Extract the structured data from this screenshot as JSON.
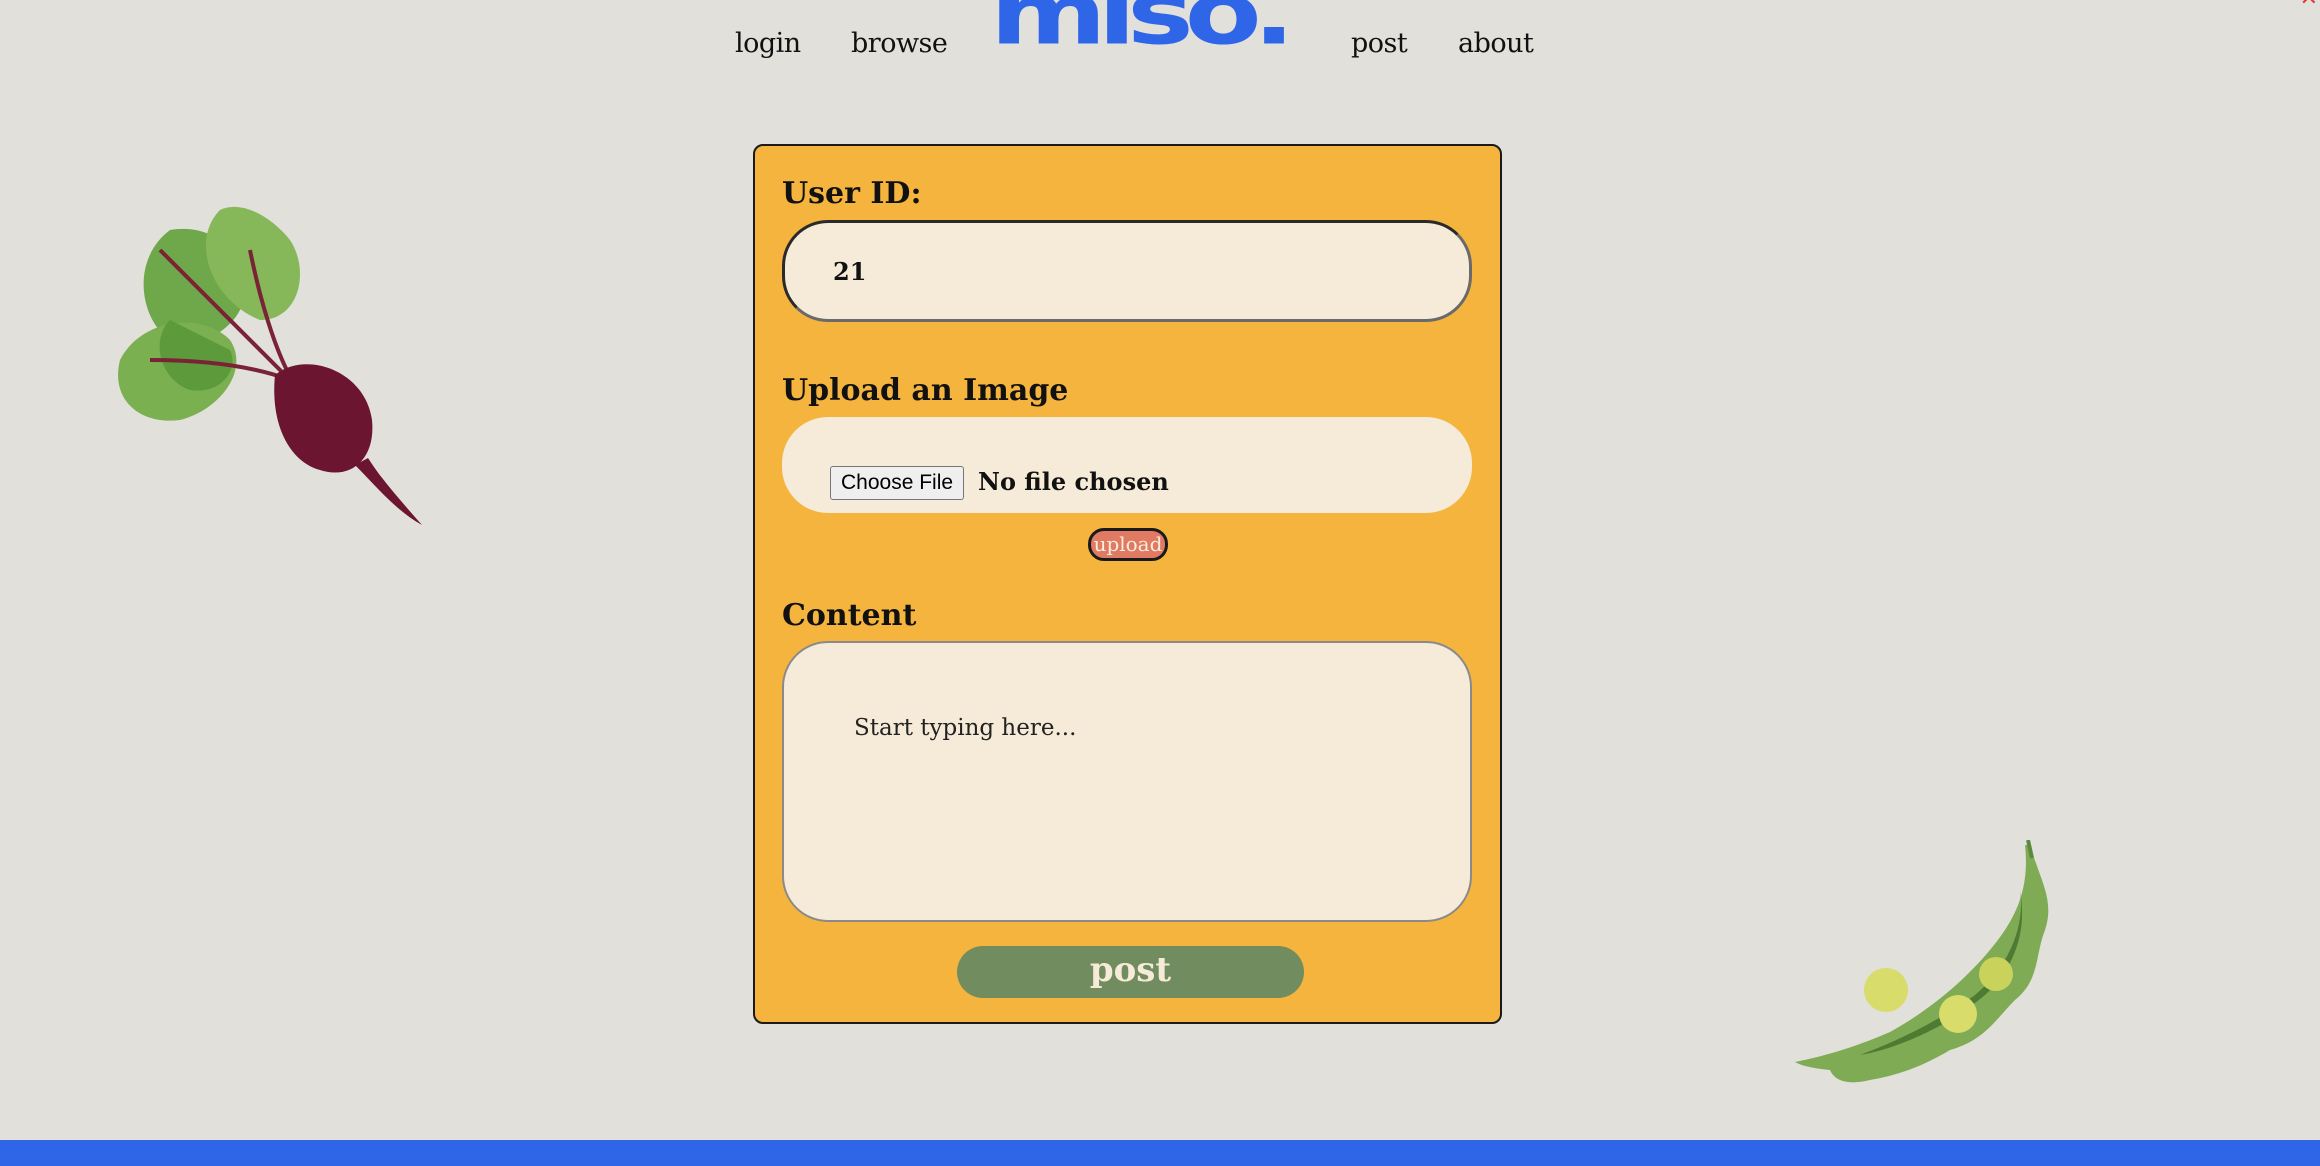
{
  "nav": {
    "links": [
      "login",
      "browse",
      "post",
      "about"
    ],
    "logo": "miso."
  },
  "form": {
    "user_id_label": "User ID:",
    "user_id_value": "21",
    "upload_label": "Upload an Image",
    "choose_file_label": "Choose File",
    "no_file_text": "No file chosen",
    "upload_button": "upload",
    "content_label": "Content",
    "content_placeholder": "Start typing here...",
    "post_button": "post"
  },
  "colors": {
    "background": "#e1e0db",
    "brand_blue": "#2f66e8",
    "panel_orange": "#f4b43e",
    "field_cream": "#f6ebd8",
    "upload_salmon": "#e07a62",
    "post_green": "#718c5e"
  },
  "icons": [
    "close-icon",
    "beet-illustration",
    "pea-pod-illustration"
  ]
}
